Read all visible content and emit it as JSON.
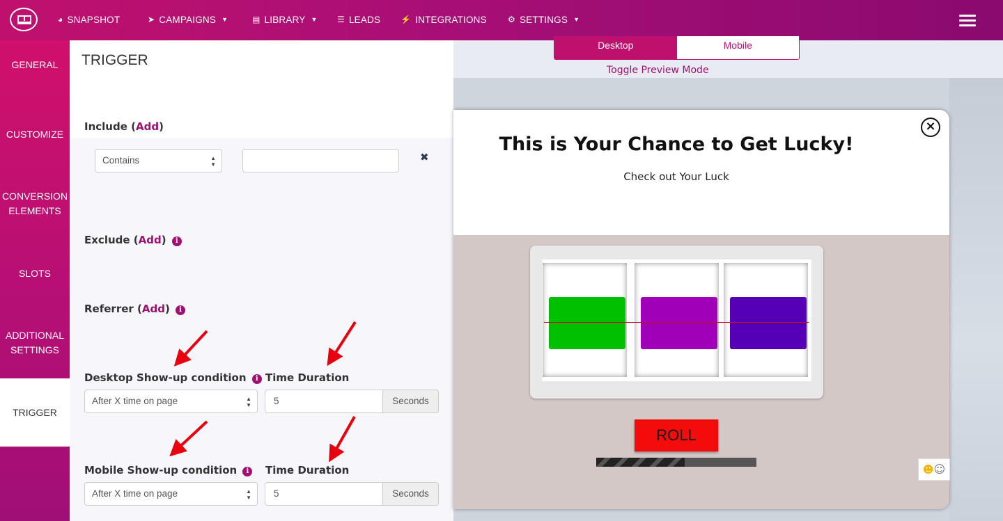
{
  "nav": {
    "items": [
      {
        "label": "SNAPSHOT",
        "icon": "tachometer-icon",
        "caret": false
      },
      {
        "label": "CAMPAIGNS",
        "icon": "paper-plane-icon",
        "caret": true
      },
      {
        "label": "LIBRARY",
        "icon": "newspaper-icon",
        "caret": true
      },
      {
        "label": "LEADS",
        "icon": "list-icon",
        "caret": false
      },
      {
        "label": "INTEGRATIONS",
        "icon": "plug-icon",
        "caret": false
      },
      {
        "label": "SETTINGS",
        "icon": "cogs-icon",
        "caret": true
      }
    ]
  },
  "sidebar": {
    "items": [
      {
        "label": "GENERAL"
      },
      {
        "label": "CUSTOMIZE"
      },
      {
        "label": "CONVERSION ELEMENTS"
      },
      {
        "label": "SLOTS"
      },
      {
        "label": "ADDITIONAL SETTINGS"
      },
      {
        "label": "TRIGGER",
        "active": true
      }
    ]
  },
  "panel": {
    "title": "TRIGGER",
    "include": {
      "label": "Include",
      "add": "Add",
      "match_value": "Contains",
      "text_value": ""
    },
    "exclude": {
      "label": "Exclude",
      "add": "Add"
    },
    "referrer": {
      "label": "Referrer",
      "add": "Add"
    },
    "desktop": {
      "condition_label": "Desktop Show-up condition",
      "condition_value": "After X time on page",
      "duration_label": "Time Duration",
      "duration_value": "5",
      "unit": "Seconds"
    },
    "mobile": {
      "condition_label": "Mobile Show-up condition",
      "condition_value": "After X time on page",
      "duration_label": "Time Duration",
      "duration_value": "5",
      "unit": "Seconds"
    }
  },
  "preview": {
    "toggle": {
      "desktop": "Desktop",
      "mobile": "Mobile",
      "active": "Desktop"
    },
    "toggle_label": "Toggle Preview Mode",
    "popup": {
      "title": "This is Your Chance to Get Lucky!",
      "subtitle": "Check out Your Luck",
      "reel_colors": [
        "#00c000",
        "#a000b8",
        "#5500b5"
      ],
      "roll_label": "ROLL",
      "progress": 0.55
    }
  },
  "colors": {
    "brand": "#c0106e",
    "accent": "#a01070",
    "annotation_arrow": "#e8000e"
  }
}
